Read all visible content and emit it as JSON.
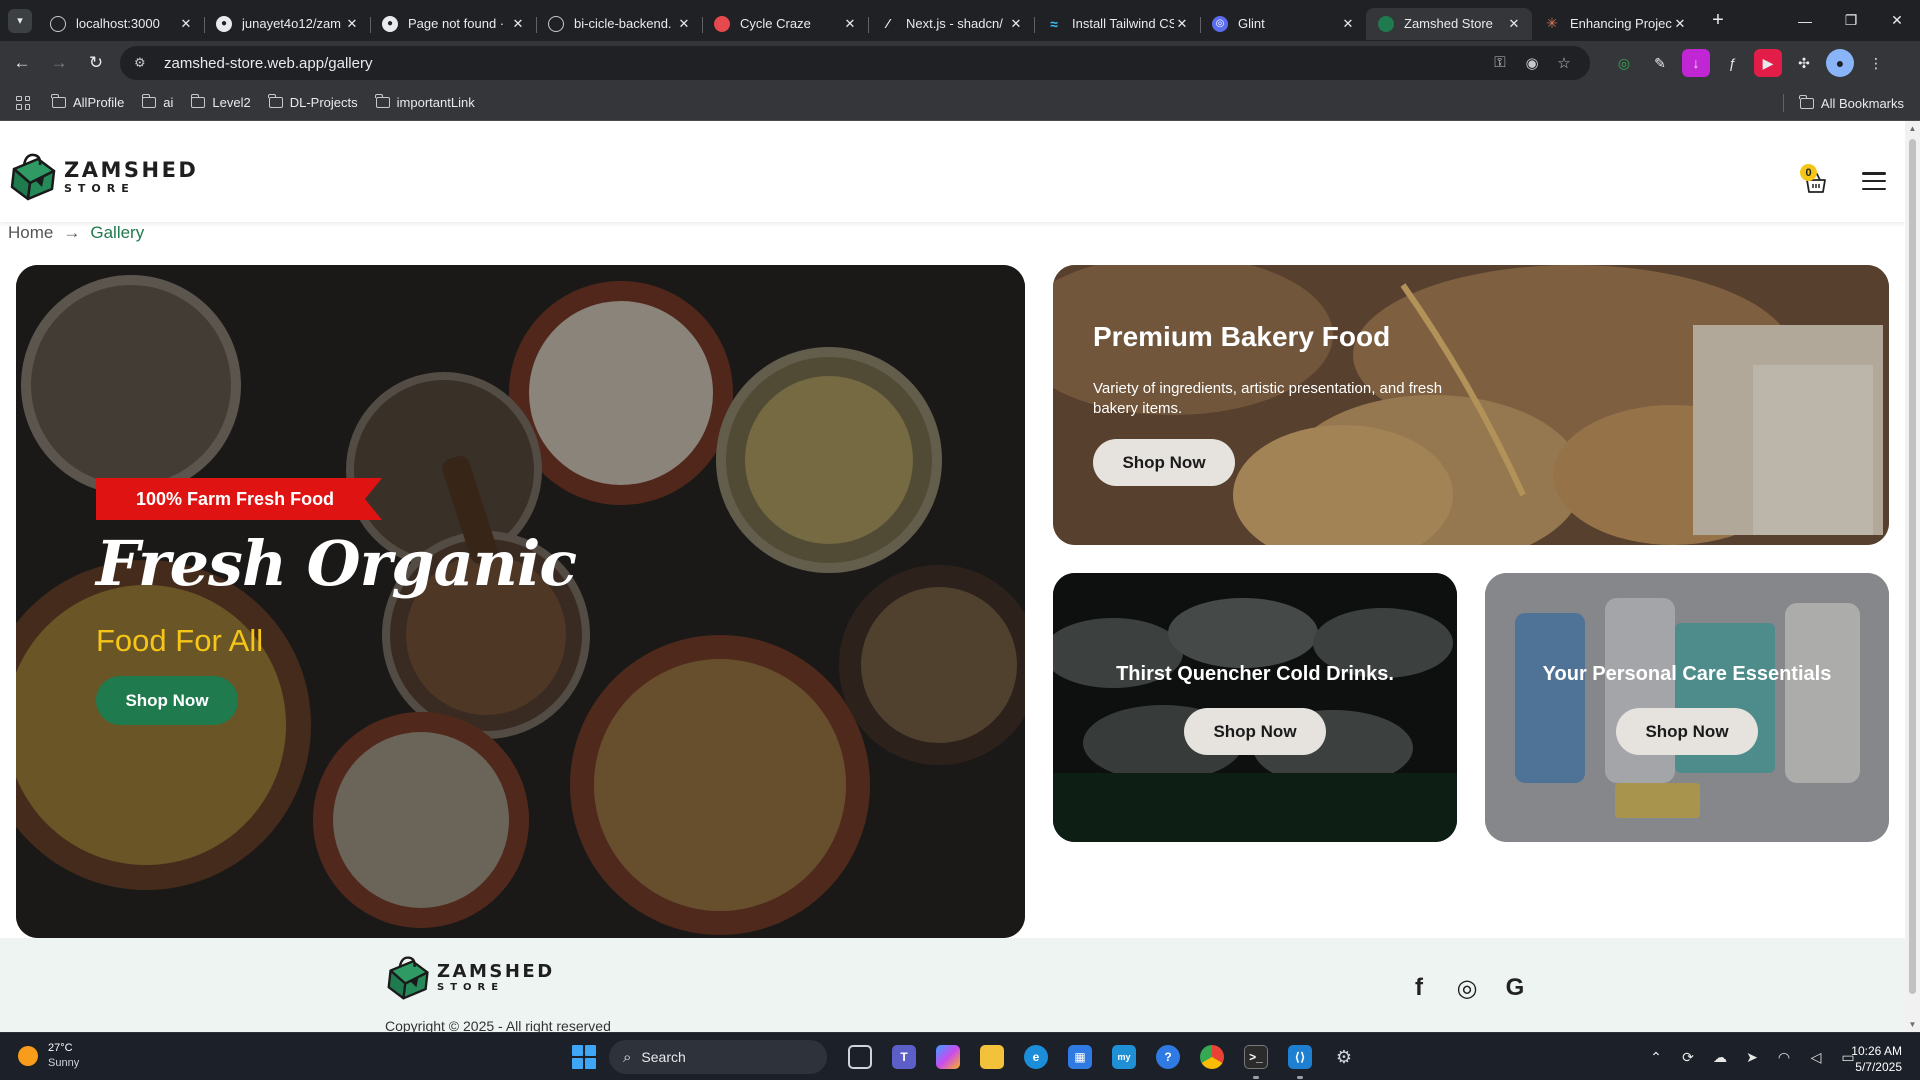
{
  "browser": {
    "tabs": [
      {
        "title": "localhost:3000",
        "icon": "globe-icon",
        "active": false
      },
      {
        "title": "junayet4o12/zam",
        "icon": "github-icon",
        "active": false
      },
      {
        "title": "Page not found ·",
        "icon": "github-icon",
        "active": false
      },
      {
        "title": "bi-cicle-backend.",
        "icon": "globe-icon",
        "active": false
      },
      {
        "title": "Cycle Craze",
        "icon": "cycle-icon",
        "active": false
      },
      {
        "title": "Next.js - shadcn/",
        "icon": "shadcn-icon",
        "active": false
      },
      {
        "title": "Install Tailwind CS",
        "icon": "tailwind-icon",
        "active": false
      },
      {
        "title": "Glint",
        "icon": "glint-icon",
        "active": false
      },
      {
        "title": "Zamshed Store",
        "icon": "zamshed-icon",
        "active": true
      },
      {
        "title": "Enhancing Project",
        "icon": "claude-icon",
        "active": false
      }
    ],
    "url": "zamshed-store.web.app/gallery",
    "bookmarks": [
      "AllProfile",
      "ai",
      "Level2",
      "DL-Projects",
      "importantLink"
    ],
    "all_bookmarks_label": "All Bookmarks"
  },
  "site": {
    "logo": {
      "line1": "ZAMSHED",
      "line2": "STORE"
    },
    "cart_count": "0",
    "breadcrumb": {
      "home": "Home",
      "current": "Gallery"
    },
    "hero": {
      "badge": "100% Farm Fresh Food",
      "title": "Fresh Organic",
      "subtitle": "Food For All",
      "button": "Shop Now"
    },
    "bakery": {
      "title": "Premium Bakery Food",
      "description": "Variety of ingredients, artistic presentation, and fresh bakery items.",
      "button": "Shop Now"
    },
    "drinks": {
      "title": "Thirst Quencher Cold Drinks.",
      "button": "Shop Now"
    },
    "care": {
      "title": "Your Personal Care Essentials",
      "button": "Shop Now"
    },
    "footer": {
      "copyright": "Copyright © 2025 - All right reserved",
      "socials": [
        {
          "name": "facebook-icon",
          "glyph": "f"
        },
        {
          "name": "whatsapp-icon",
          "glyph": "◎"
        },
        {
          "name": "google-icon",
          "glyph": "G"
        }
      ]
    },
    "colors": {
      "brand_green": "#1f7a4d",
      "accent_yellow": "#f5c518",
      "ribbon_red": "#e01313"
    }
  },
  "taskbar": {
    "weather": {
      "temp": "27°C",
      "condition": "Sunny"
    },
    "search_placeholder": "Search",
    "time": "10:26 AM",
    "date": "5/7/2025"
  }
}
